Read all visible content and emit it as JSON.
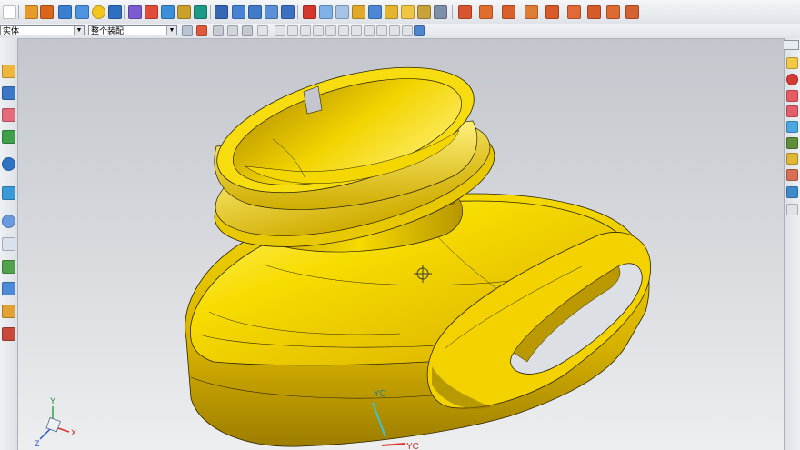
{
  "toolbar2": {
    "selection_filter": "实体",
    "assembly_scope": "整个装配"
  },
  "viewport": {
    "axis_labels": {
      "x": "X",
      "y": "Y",
      "z": "Z"
    },
    "wcs_label": "YC",
    "wcs_label_bottom": "YC"
  },
  "colors": {
    "part": "#f5d800",
    "part_shadow": "#c9a400",
    "part_dark": "#9b7c00",
    "edge": "#2a2400",
    "bg_top": "#c3c6cc",
    "bg_bottom": "#eceef0"
  },
  "icons": [
    "new-file-icon",
    "open-icon",
    "save-icon",
    "feature-icon",
    "sketch-icon",
    "extrude-icon",
    "revolve-icon",
    "sphere-icon",
    "block-icon",
    "measure-icon",
    "wcs-icon",
    "fit-icon",
    "zoom-icon",
    "rotate-icon",
    "shaded-icon",
    "wireframe-icon",
    "view-orient-icon",
    "layer-icon",
    "render-icon",
    "analysis-icon"
  ]
}
